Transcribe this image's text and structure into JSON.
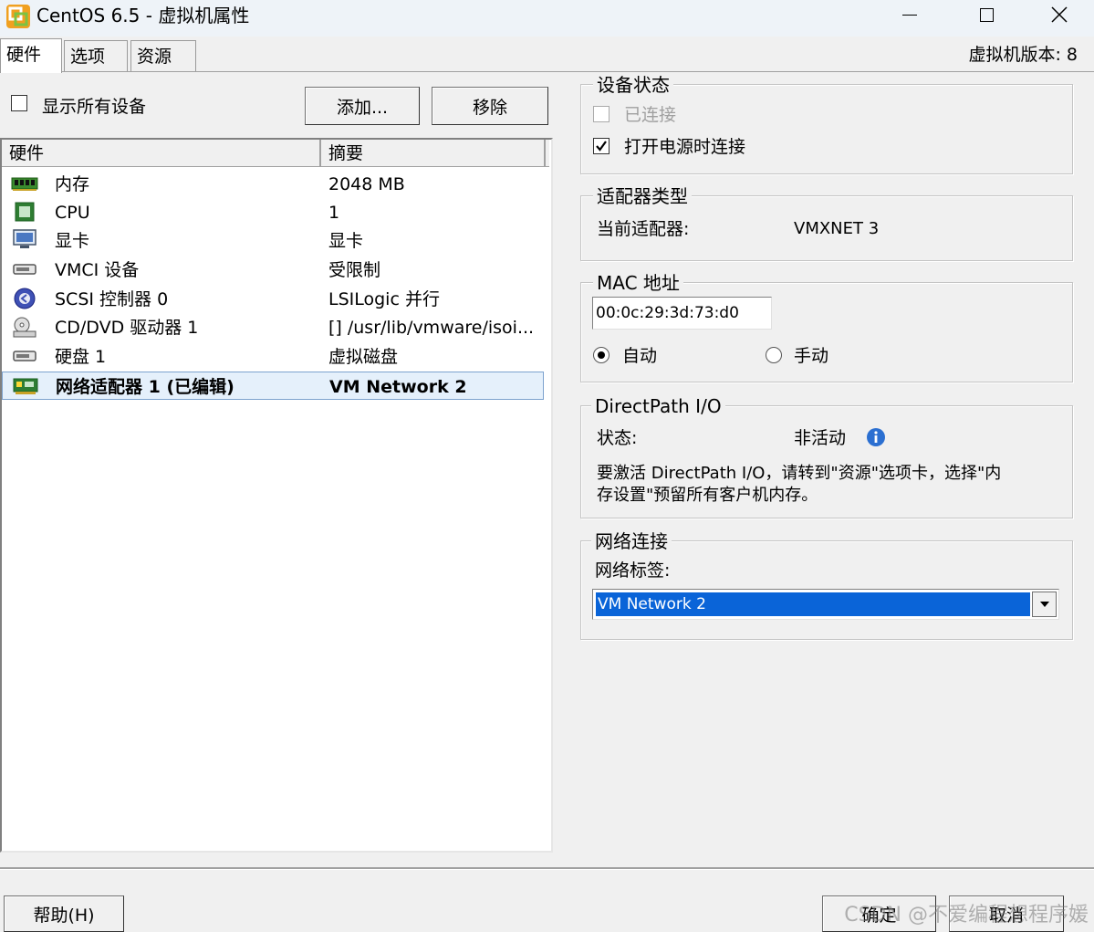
{
  "window": {
    "title": "CentOS 6.5 - 虚拟机属性",
    "app_icon": "vsphere-icon",
    "controls": [
      "minimize-icon",
      "maximize-icon",
      "close-icon"
    ]
  },
  "tabs": [
    {
      "label": "硬件",
      "active": true
    },
    {
      "label": "选项",
      "active": false
    },
    {
      "label": "资源",
      "active": false
    }
  ],
  "version_label": "虚拟机版本: 8",
  "show_all_devices": {
    "label": "显示所有设备",
    "checked": false
  },
  "buttons": {
    "add": "添加...",
    "remove": "移除",
    "help": "帮助(H)",
    "ok": "确定",
    "cancel": "取消"
  },
  "hardware_table": {
    "headers": [
      "硬件",
      "摘要"
    ],
    "rows": [
      {
        "icon": "memory-icon",
        "name": "内存",
        "summary": "2048 MB",
        "selected": false
      },
      {
        "icon": "cpu-icon",
        "name": "CPU",
        "summary": "1",
        "selected": false
      },
      {
        "icon": "display-icon",
        "name": "显卡",
        "summary": "显卡",
        "selected": false
      },
      {
        "icon": "vmci-icon",
        "name": "VMCI 设备",
        "summary": "受限制",
        "selected": false
      },
      {
        "icon": "scsi-controller-icon",
        "name": "SCSI 控制器 0",
        "summary": "LSILogic 并行",
        "selected": false
      },
      {
        "icon": "cd-dvd-icon",
        "name": "CD/DVD 驱动器 1",
        "summary": "[] /usr/lib/vmware/isoi...",
        "selected": false
      },
      {
        "icon": "hard-disk-icon",
        "name": "硬盘 1",
        "summary": "虚拟磁盘",
        "selected": false
      },
      {
        "icon": "network-adapter-icon",
        "name": "网络适配器 1 (已编辑)",
        "summary": "VM Network 2",
        "selected": true
      }
    ]
  },
  "device_status": {
    "legend": "设备状态",
    "connected": {
      "label": "已连接",
      "checked": false,
      "disabled": true
    },
    "connect_at_power_on": {
      "label": "打开电源时连接",
      "checked": true
    }
  },
  "adapter_type": {
    "legend": "适配器类型",
    "current_label": "当前适配器:",
    "current_value": "VMXNET 3"
  },
  "mac_address": {
    "legend": "MAC 地址",
    "value": "00:0c:29:3d:73:d0",
    "auto_label": "自动",
    "manual_label": "手动",
    "selected": "auto"
  },
  "directpath": {
    "legend": "DirectPath I/O",
    "status_label": "状态:",
    "status_value": "非活动",
    "info_icon": "info-icon",
    "note_line1": "要激活 DirectPath I/O，请转到\"资源\"选项卡，选择\"内",
    "note_line2": "存设置\"预留所有客户机内存。"
  },
  "network_connection": {
    "legend": "网络连接",
    "label_caption": "网络标签:",
    "selected_value": "VM Network 2"
  },
  "watermark": "CSDN @不爱编程想程序媛"
}
